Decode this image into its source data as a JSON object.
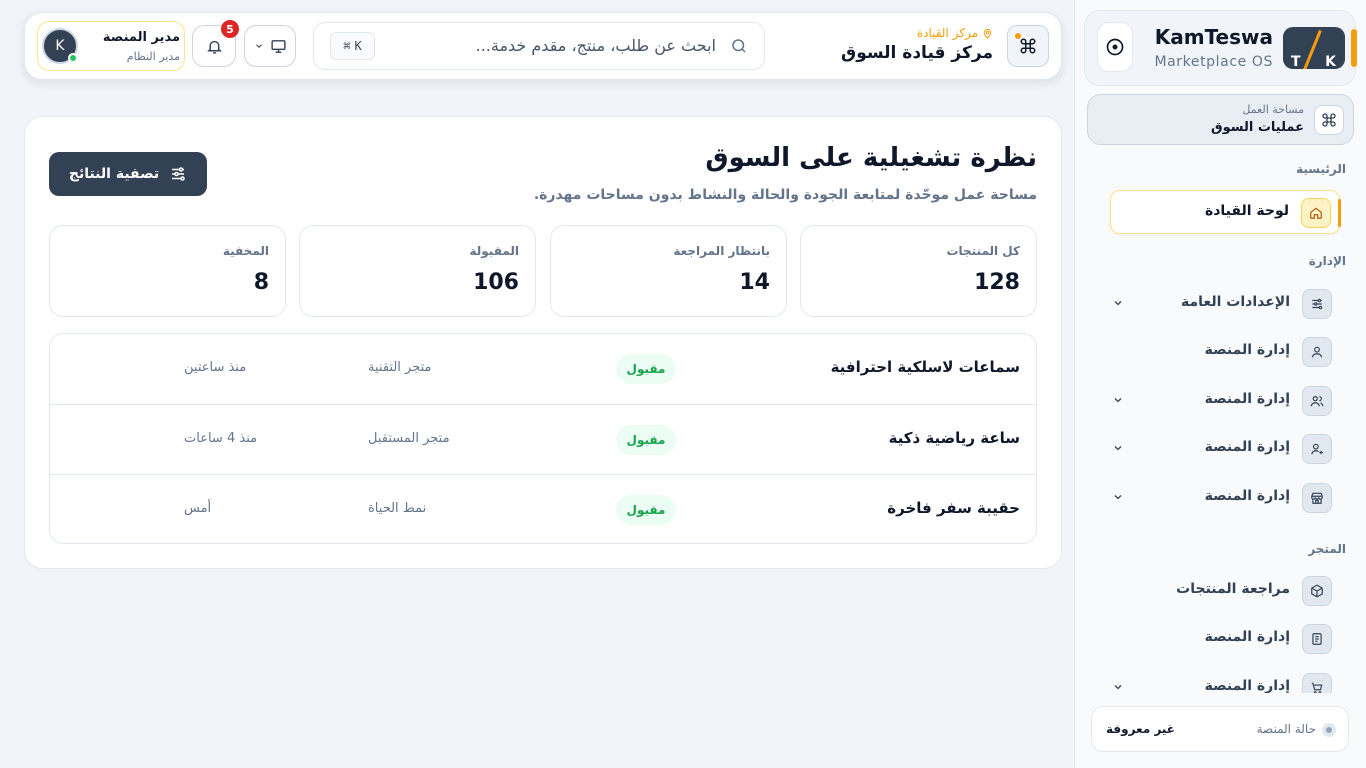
{
  "brand": {
    "name": "KamTeswa",
    "subtitle": "Marketplace OS",
    "logo_left": "T",
    "logo_right": "K"
  },
  "workspace": {
    "label": "مساحة العمل",
    "value": "عمليات السوق"
  },
  "sidebar": {
    "sections": {
      "main": "الرئيسية",
      "admin": "الإدارة",
      "store": "المتجر"
    },
    "items": [
      {
        "label": "لوحة القيادة",
        "icon": "home-icon",
        "active": true
      },
      {
        "label": "الإعدادات العامة",
        "icon": "sliders-icon",
        "has_children": true
      },
      {
        "label": "إدارة المنصة",
        "icon": "user-icon"
      },
      {
        "label": "إدارة المنصة",
        "icon": "users-icon",
        "has_children": true
      },
      {
        "label": "إدارة المنصة",
        "icon": "user-plus-icon",
        "has_children": true
      },
      {
        "label": "إدارة المنصة",
        "icon": "store-icon",
        "has_children": true
      },
      {
        "label": "مراجعة المنتجات",
        "icon": "box-icon"
      },
      {
        "label": "إدارة المنصة",
        "icon": "receipt-icon"
      },
      {
        "label": "إدارة المنصة",
        "icon": "cart-icon",
        "has_children": true
      }
    ],
    "status": {
      "label": "حالة المنصة",
      "value": "غير معروفة"
    }
  },
  "header": {
    "eyebrow": "مركز القيادة",
    "title": "مركز قيادة السوق",
    "search_placeholder": "ابحث عن طلب، منتج، مقدم خدمة...",
    "shortcut_symbol": "⌘",
    "shortcut_key": "K",
    "notifications_count": "5",
    "user": {
      "name": "مدير المنصة",
      "role": "مدير النظام",
      "initial": "K"
    }
  },
  "main": {
    "title": "نظرة تشغيلية على السوق",
    "subtitle": "مساحة عمل موحّدة لمتابعة الجودة والحالة والنشاط بدون مساحات مهدرة.",
    "filter_label": "تصفية النتائج",
    "stats": [
      {
        "label": "كل المنتجات",
        "value": "128"
      },
      {
        "label": "بانتظار المراجعة",
        "value": "14"
      },
      {
        "label": "المقبولة",
        "value": "106"
      },
      {
        "label": "المخفية",
        "value": "8"
      }
    ],
    "rows": [
      {
        "name": "سماعات لاسلكية احترافية",
        "status": "مقبول",
        "store": "متجر التقنية",
        "time": "منذ ساعتين"
      },
      {
        "name": "ساعة رياضية ذكية",
        "status": "مقبول",
        "store": "متجر المستقبل",
        "time": "منذ 4 ساعات"
      },
      {
        "name": "حقيبة سفر فاخرة",
        "status": "مقبول",
        "store": "نمط الحياة",
        "time": "أمس"
      }
    ]
  },
  "colors": {
    "accent": "#f59e0b",
    "primary": "#334155",
    "success": "#16a34a",
    "danger": "#dc2626"
  }
}
